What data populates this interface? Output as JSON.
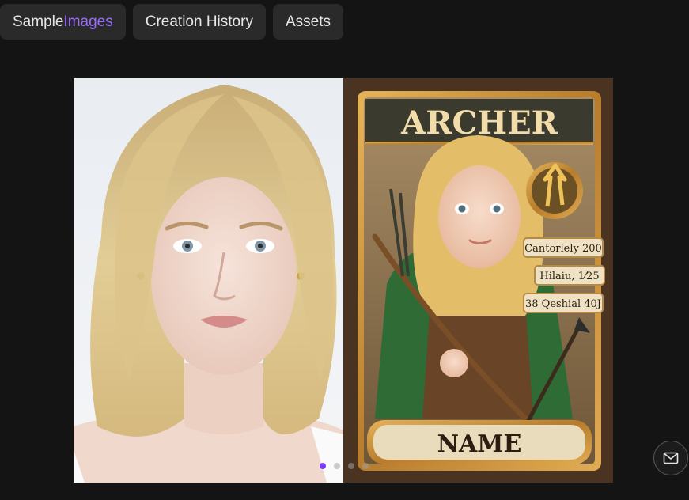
{
  "tabs": [
    {
      "label_part1": "Sample ",
      "label_part2": "Images"
    },
    {
      "label": "Creation History"
    },
    {
      "label": "Assets"
    }
  ],
  "showcase": {
    "card": {
      "title": "ARCHER",
      "name": "NAME",
      "stats": [
        "Cantorlely 200",
        "Hilaiu, 1⁄25",
        "38 Qeshial 40J"
      ]
    },
    "carousel": {
      "count": 4,
      "active": 1
    }
  },
  "colors": {
    "accent": "#9b6bff",
    "active_dot": "#7b3cf2",
    "card_gold": "#c8913a",
    "cloak_green": "#2f6b35"
  },
  "icons": {
    "mail": "mail-icon"
  }
}
